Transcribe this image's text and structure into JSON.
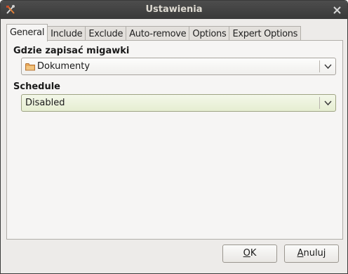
{
  "window": {
    "title": "Ustawienia"
  },
  "tabs": [
    {
      "label": "General",
      "active": true
    },
    {
      "label": "Include",
      "active": false
    },
    {
      "label": "Exclude",
      "active": false
    },
    {
      "label": "Auto-remove",
      "active": false
    },
    {
      "label": "Options",
      "active": false
    },
    {
      "label": "Expert Options",
      "active": false
    }
  ],
  "general": {
    "snapshot_location_label": "Gdzie zapisać migawki",
    "snapshot_location_value": "Dokumenty",
    "schedule_label": "Schedule",
    "schedule_value": "Disabled"
  },
  "buttons": {
    "ok_mnemonic": "O",
    "ok_rest": "K",
    "cancel_mnemonic": "A",
    "cancel_rest": "nuluj"
  },
  "colors": {
    "titlebar": "#3f3f3f",
    "window_bg": "#edebe9",
    "schedule_combo_bg": "#e6eed2"
  },
  "icons": {
    "app": "tools-icon",
    "close": "close-icon",
    "folder": "folder-icon",
    "dropdown": "chevron-down-icon"
  }
}
